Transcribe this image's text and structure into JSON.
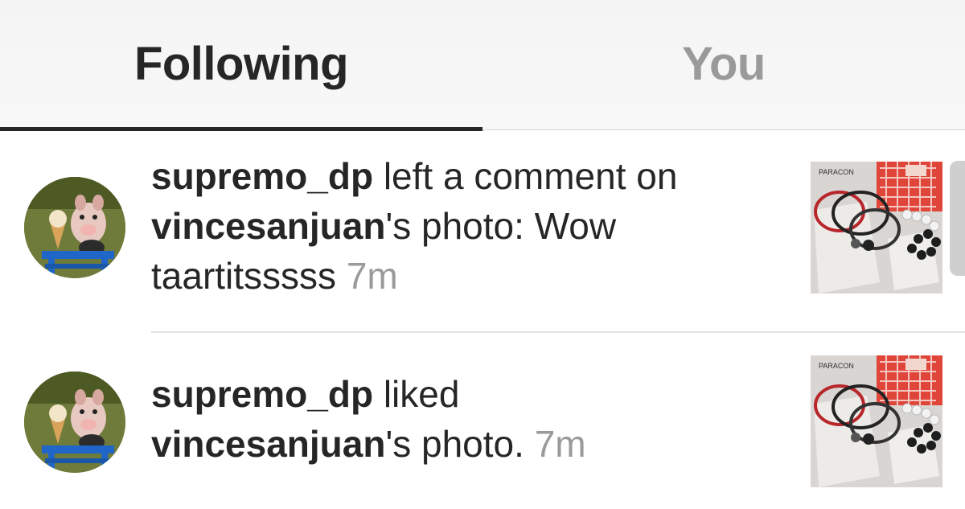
{
  "tabs": [
    {
      "label": "Following",
      "active": true
    },
    {
      "label": "You",
      "active": false
    }
  ],
  "notifications": [
    {
      "username": "supremo_dp",
      "action": " left a comment on ",
      "target_user": "vincesanjuan",
      "suffix": "'s photo: Wow taartitsssss ",
      "time": "7m",
      "avatar_icon": "pig-avatar-icon",
      "thumbnail_icon": "bracelets-photo-thumbnail"
    },
    {
      "username": "supremo_dp",
      "action": " liked ",
      "target_user": "vincesanjuan",
      "suffix": "'s photo. ",
      "time": "7m",
      "avatar_icon": "pig-avatar-icon",
      "thumbnail_icon": "bracelets-photo-thumbnail"
    }
  ],
  "colors": {
    "text_primary": "#262626",
    "text_secondary": "#9a9a9a",
    "tab_bar_bg": "#f6f6f6",
    "divider": "#e3e3e3"
  }
}
